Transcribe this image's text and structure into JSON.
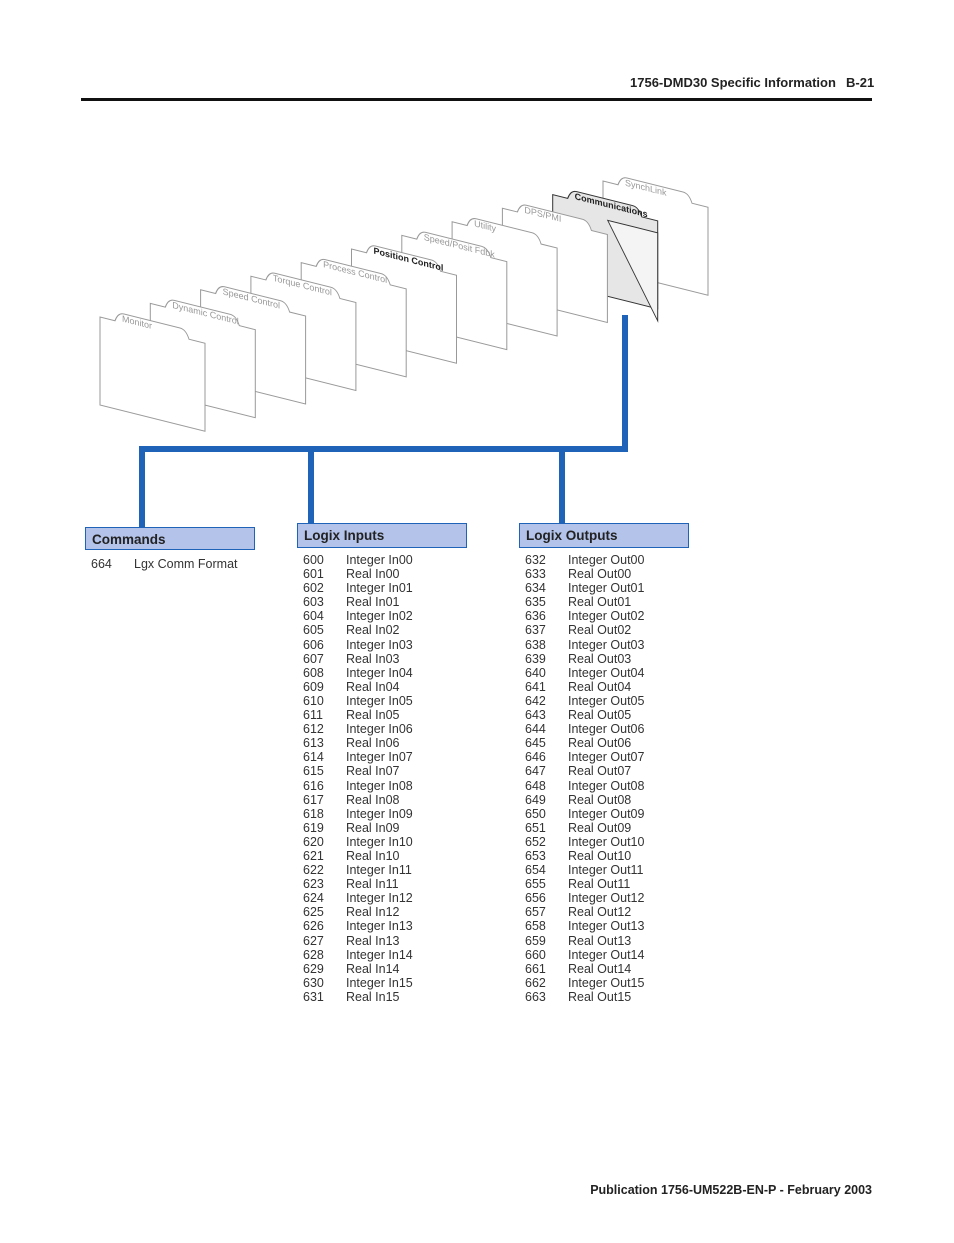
{
  "header": {
    "title": "1756-DMD30 Specific Information",
    "page": "B-21"
  },
  "folders": [
    {
      "label": "Monitor",
      "bold": false
    },
    {
      "label": "Dynamic Control",
      "bold": false
    },
    {
      "label": "Speed Control",
      "bold": false
    },
    {
      "label": "Torque Control",
      "bold": false
    },
    {
      "label": "Process Control",
      "bold": false
    },
    {
      "label": "Position Control",
      "bold": true
    },
    {
      "label": "Speed/Posit Fdbk",
      "bold": false
    },
    {
      "label": "Utility",
      "bold": false
    },
    {
      "label": "DPS/PMI",
      "bold": false
    },
    {
      "label": "Communications",
      "bold": true,
      "highlighted": true
    },
    {
      "label": "SynchLink",
      "bold": false
    }
  ],
  "colors": {
    "connector": "#1f63b8",
    "box_fill": "#b3c3ea",
    "highlight_folder": "#e6e6e6"
  },
  "commands": {
    "title": "Commands",
    "rows": [
      [
        "664",
        "Lgx Comm Format"
      ]
    ]
  },
  "inputs": {
    "title": "Logix Inputs",
    "rows": [
      [
        "600",
        "Integer In00"
      ],
      [
        "601",
        "Real In00"
      ],
      [
        "602",
        "Integer In01"
      ],
      [
        "603",
        "Real In01"
      ],
      [
        "604",
        "Integer In02"
      ],
      [
        "605",
        "Real In02"
      ],
      [
        "606",
        "Integer In03"
      ],
      [
        "607",
        "Real In03"
      ],
      [
        "608",
        "Integer In04"
      ],
      [
        "609",
        "Real In04"
      ],
      [
        "610",
        "Integer In05"
      ],
      [
        "611",
        "Real In05"
      ],
      [
        "612",
        "Integer In06"
      ],
      [
        "613",
        "Real In06"
      ],
      [
        "614",
        "Integer In07"
      ],
      [
        "615",
        "Real In07"
      ],
      [
        "616",
        "Integer In08"
      ],
      [
        "617",
        "Real In08"
      ],
      [
        "618",
        "Integer In09"
      ],
      [
        "619",
        "Real In09"
      ],
      [
        "620",
        "Integer In10"
      ],
      [
        "621",
        "Real In10"
      ],
      [
        "622",
        "Integer In11"
      ],
      [
        "623",
        "Real In11"
      ],
      [
        "624",
        "Integer In12"
      ],
      [
        "625",
        "Real In12"
      ],
      [
        "626",
        "Integer In13"
      ],
      [
        "627",
        "Real In13"
      ],
      [
        "628",
        "Integer In14"
      ],
      [
        "629",
        "Real In14"
      ],
      [
        "630",
        "Integer In15"
      ],
      [
        "631",
        "Real In15"
      ]
    ]
  },
  "outputs": {
    "title": "Logix Outputs",
    "rows": [
      [
        "632",
        "Integer Out00"
      ],
      [
        "633",
        "Real Out00"
      ],
      [
        "634",
        "Integer Out01"
      ],
      [
        "635",
        "Real Out01"
      ],
      [
        "636",
        "Integer Out02"
      ],
      [
        "637",
        "Real Out02"
      ],
      [
        "638",
        "Integer Out03"
      ],
      [
        "639",
        "Real Out03"
      ],
      [
        "640",
        "Integer Out04"
      ],
      [
        "641",
        "Real Out04"
      ],
      [
        "642",
        "Integer Out05"
      ],
      [
        "643",
        "Real Out05"
      ],
      [
        "644",
        "Integer Out06"
      ],
      [
        "645",
        "Real Out06"
      ],
      [
        "646",
        "Integer Out07"
      ],
      [
        "647",
        "Real Out07"
      ],
      [
        "648",
        "Integer Out08"
      ],
      [
        "649",
        "Real Out08"
      ],
      [
        "650",
        "Integer Out09"
      ],
      [
        "651",
        "Real Out09"
      ],
      [
        "652",
        "Integer Out10"
      ],
      [
        "653",
        "Real Out10"
      ],
      [
        "654",
        "Integer Out11"
      ],
      [
        "655",
        "Real Out11"
      ],
      [
        "656",
        "Integer Out12"
      ],
      [
        "657",
        "Real Out12"
      ],
      [
        "658",
        "Integer Out13"
      ],
      [
        "659",
        "Real Out13"
      ],
      [
        "660",
        "Integer Out14"
      ],
      [
        "661",
        "Real Out14"
      ],
      [
        "662",
        "Integer Out15"
      ],
      [
        "663",
        "Real Out15"
      ]
    ]
  },
  "footer": "Publication 1756-UM522B-EN-P - February 2003"
}
